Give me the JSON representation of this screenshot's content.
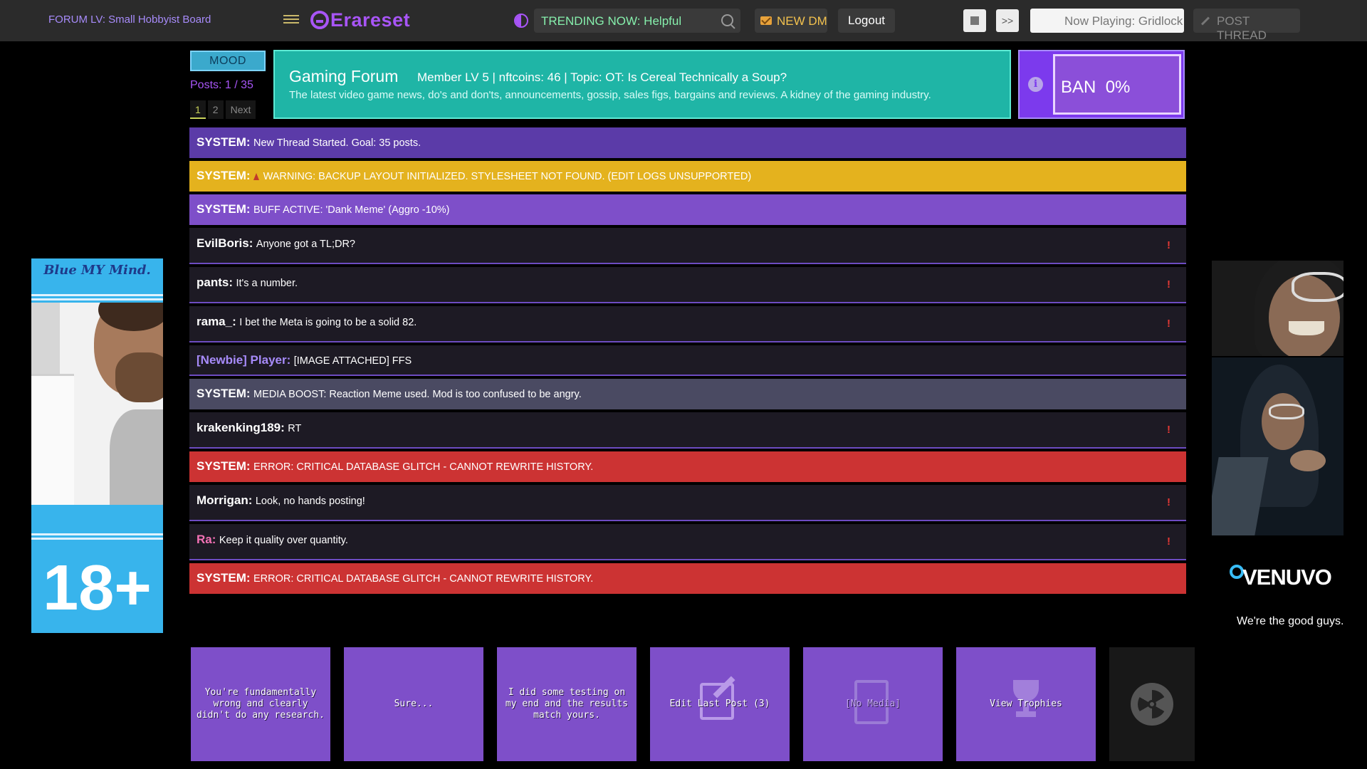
{
  "topbar": {
    "board_title": "FORUM LV: Small Hobbyist Board",
    "logo_text": "Erareset",
    "trending": "TRENDING NOW: Helpful",
    "new_dm": "NEW DM",
    "logout": "Logout",
    "next_track": ">>",
    "now_playing": "Now Playing: Gridlock",
    "post_thread": "POST THREAD",
    "icons": [
      "menu-icon",
      "contrast-icon",
      "search-icon",
      "mail-icon",
      "stop-icon",
      "pencil-icon"
    ],
    "colors": {
      "bar": "#2b2b2b",
      "brand": "#a855f7",
      "trending_text": "#86efac",
      "dm_text": "#f2c14e"
    }
  },
  "header": {
    "mood": "MOOD",
    "posts_count": "Posts: 1 / 35",
    "pages": [
      "1",
      "2",
      "Next"
    ],
    "active_page": "1",
    "forum_title": "Gaming Forum",
    "forum_meta": "Member LV 5 | nftcoins: 46 | Topic: OT: Is Cereal Technically a Soup?",
    "forum_description": "The latest video game news, do's and don'ts, announcements, gossip, sales figs, bargains and reviews. A kidney of the gaming industry.",
    "ban_label": "BAN",
    "ban_value": "0%",
    "colors": {
      "forum_header": "#1fb5a6",
      "ban_box": "#7c3aed"
    }
  },
  "feed": [
    {
      "type": "system",
      "style": "purple",
      "author": "SYSTEM:",
      "text": "New Thread Started. Goal: 35 posts."
    },
    {
      "type": "system",
      "style": "yellow",
      "author": "SYSTEM:",
      "text": "WARNING: BACKUP LAYOUT INITIALIZED. STYLESHEET NOT FOUND. (EDIT LOGS UNSUPPORTED)"
    },
    {
      "type": "system",
      "style": "violet",
      "author": "SYSTEM:",
      "text": "BUFF ACTIVE: 'Dank Meme' (Aggro -10%)"
    },
    {
      "type": "user",
      "author": "EvilBoris:",
      "text": "Anyone got a TL;DR?",
      "flag": "!"
    },
    {
      "type": "user",
      "author": "pants:",
      "text": "It's a number.",
      "flag": "!"
    },
    {
      "type": "user",
      "author": "rama_:",
      "text": "I bet the Meta is going to be a solid 82.",
      "flag": "!"
    },
    {
      "type": "user",
      "author": "[Newbie] Player:",
      "text": "[IMAGE ATTACHED] FFS",
      "author_color": "#a78bfa"
    },
    {
      "type": "system",
      "style": "grey",
      "author": "SYSTEM:",
      "text": "MEDIA BOOST: Reaction Meme used. Mod is too confused to be angry."
    },
    {
      "type": "user",
      "author": "krakenking189:",
      "text": "RT",
      "flag": "!"
    },
    {
      "type": "system",
      "style": "red",
      "author": "SYSTEM:",
      "text": "ERROR: CRITICAL DATABASE GLITCH - CANNOT REWRITE HISTORY."
    },
    {
      "type": "user",
      "author": "Morrigan:",
      "text": "Look, no hands posting!",
      "flag": "!"
    },
    {
      "type": "user",
      "author": "Ra:",
      "text": "Keep it quality over quantity.",
      "flag": "!",
      "author_color": "#f472b6"
    },
    {
      "type": "system",
      "style": "red",
      "author": "SYSTEM:",
      "text": "ERROR: CRITICAL DATABASE GLITCH - CANNOT REWRITE HISTORY."
    }
  ],
  "ads": {
    "left_title": "Blue MY Mind.",
    "left_age": "18+",
    "right_brand": "VENUVO",
    "right_tagline": "We're the good guys."
  },
  "quick_replies": [
    {
      "label": "You're fundamentally wrong and clearly didn't do any research.",
      "icon": ""
    },
    {
      "label": "Sure...",
      "icon": ""
    },
    {
      "label": "I did some testing on my end and the results match yours.",
      "icon": ""
    },
    {
      "label": "Edit Last Post (3)",
      "icon": "edit-icon"
    },
    {
      "label": "[No Media]",
      "icon": "document-icon"
    },
    {
      "label": "View Trophies",
      "icon": "trophy-icon"
    },
    {
      "label": "",
      "icon": "radiation-icon"
    }
  ]
}
